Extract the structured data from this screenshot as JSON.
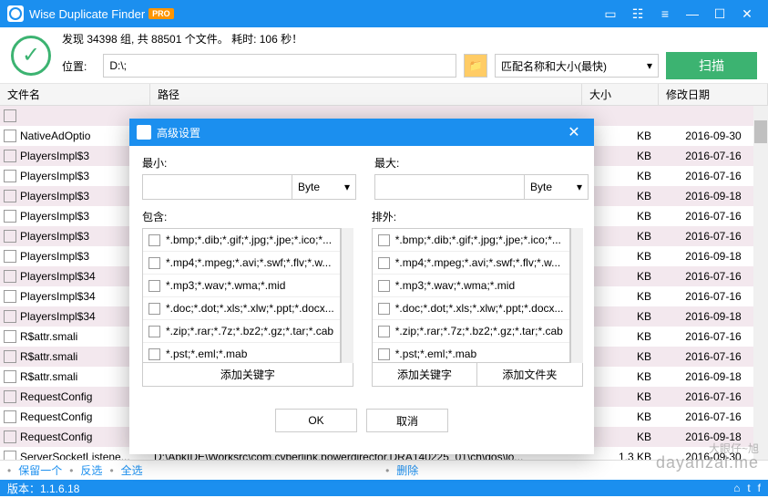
{
  "app": {
    "title": "Wise Duplicate Finder",
    "badge": "PRO",
    "version": "版本：1.1.6.18"
  },
  "stats": "发现 34398 组, 共 88501 个文件。 耗时: 106 秒！",
  "location": {
    "label": "位置:",
    "value": "D:\\;"
  },
  "match": {
    "selected": "匹配名称和大小(最快)"
  },
  "scan_label": "扫描",
  "columns": {
    "name": "文件名",
    "path": "路径",
    "size": "大小",
    "date": "修改日期"
  },
  "rows": [
    {
      "name": "",
      "path": "",
      "size": "",
      "date": ""
    },
    {
      "name": "NativeAdOptio",
      "path": "",
      "size": "KB",
      "date": "2016-09-30"
    },
    {
      "name": "PlayersImpl$3",
      "path": "",
      "size": "KB",
      "date": "2016-07-16"
    },
    {
      "name": "PlayersImpl$3",
      "path": "",
      "size": "KB",
      "date": "2016-07-16"
    },
    {
      "name": "PlayersImpl$3",
      "path": "",
      "size": "KB",
      "date": "2016-09-18"
    },
    {
      "name": "PlayersImpl$3",
      "path": "",
      "size": "KB",
      "date": "2016-07-16"
    },
    {
      "name": "PlayersImpl$3",
      "path": "",
      "size": "KB",
      "date": "2016-07-16"
    },
    {
      "name": "PlayersImpl$3",
      "path": "",
      "size": "KB",
      "date": "2016-09-18"
    },
    {
      "name": "PlayersImpl$34",
      "path": "",
      "size": "KB",
      "date": "2016-07-16"
    },
    {
      "name": "PlayersImpl$34",
      "path": "",
      "size": "KB",
      "date": "2016-07-16"
    },
    {
      "name": "PlayersImpl$34",
      "path": "",
      "size": "KB",
      "date": "2016-09-18"
    },
    {
      "name": "R$attr.smali",
      "path": "",
      "size": "KB",
      "date": "2016-07-16"
    },
    {
      "name": "R$attr.smali",
      "path": "",
      "size": "KB",
      "date": "2016-07-16"
    },
    {
      "name": "R$attr.smali",
      "path": "",
      "size": "KB",
      "date": "2016-09-18"
    },
    {
      "name": "RequestConfig",
      "path": "",
      "size": "KB",
      "date": "2016-07-16"
    },
    {
      "name": "RequestConfig",
      "path": "",
      "size": "KB",
      "date": "2016-07-16"
    },
    {
      "name": "RequestConfig",
      "path": "",
      "size": "KB",
      "date": "2016-09-18"
    },
    {
      "name": "ServerSocketListene...",
      "path": "D:\\ApkIDE\\Worksrc\\com.cyberlink.powerdirector.DRA140225_01\\ch\\qos\\lo...",
      "size": "1.3 KB",
      "date": "2016-09-30"
    }
  ],
  "footer": {
    "keep": "保留一个",
    "invert": "反选",
    "all": "全选",
    "delete": "删除"
  },
  "dialog": {
    "title": "高级设置",
    "min_label": "最小:",
    "max_label": "最大:",
    "unit": "Byte",
    "include_label": "包含:",
    "exclude_label": "排外:",
    "patterns": [
      "*.bmp;*.dib;*.gif;*.jpg;*.jpe;*.ico;*...",
      "*.mp4;*.mpeg;*.avi;*.swf;*.flv;*.w...",
      "*.mp3;*.wav;*.wma;*.mid",
      "*.doc;*.dot;*.xls;*.xlw;*.ppt;*.docx...",
      "*.zip;*.rar;*.7z;*.bz2;*.gz;*.tar;*.cab",
      "*.pst;*.eml;*.mab"
    ],
    "add_keyword": "添加关键字",
    "add_folder": "添加文件夹",
    "ok": "OK",
    "cancel": "取消"
  },
  "watermark": {
    "line1": "大眼仔~旭",
    "line2": "dayanzai.me"
  }
}
